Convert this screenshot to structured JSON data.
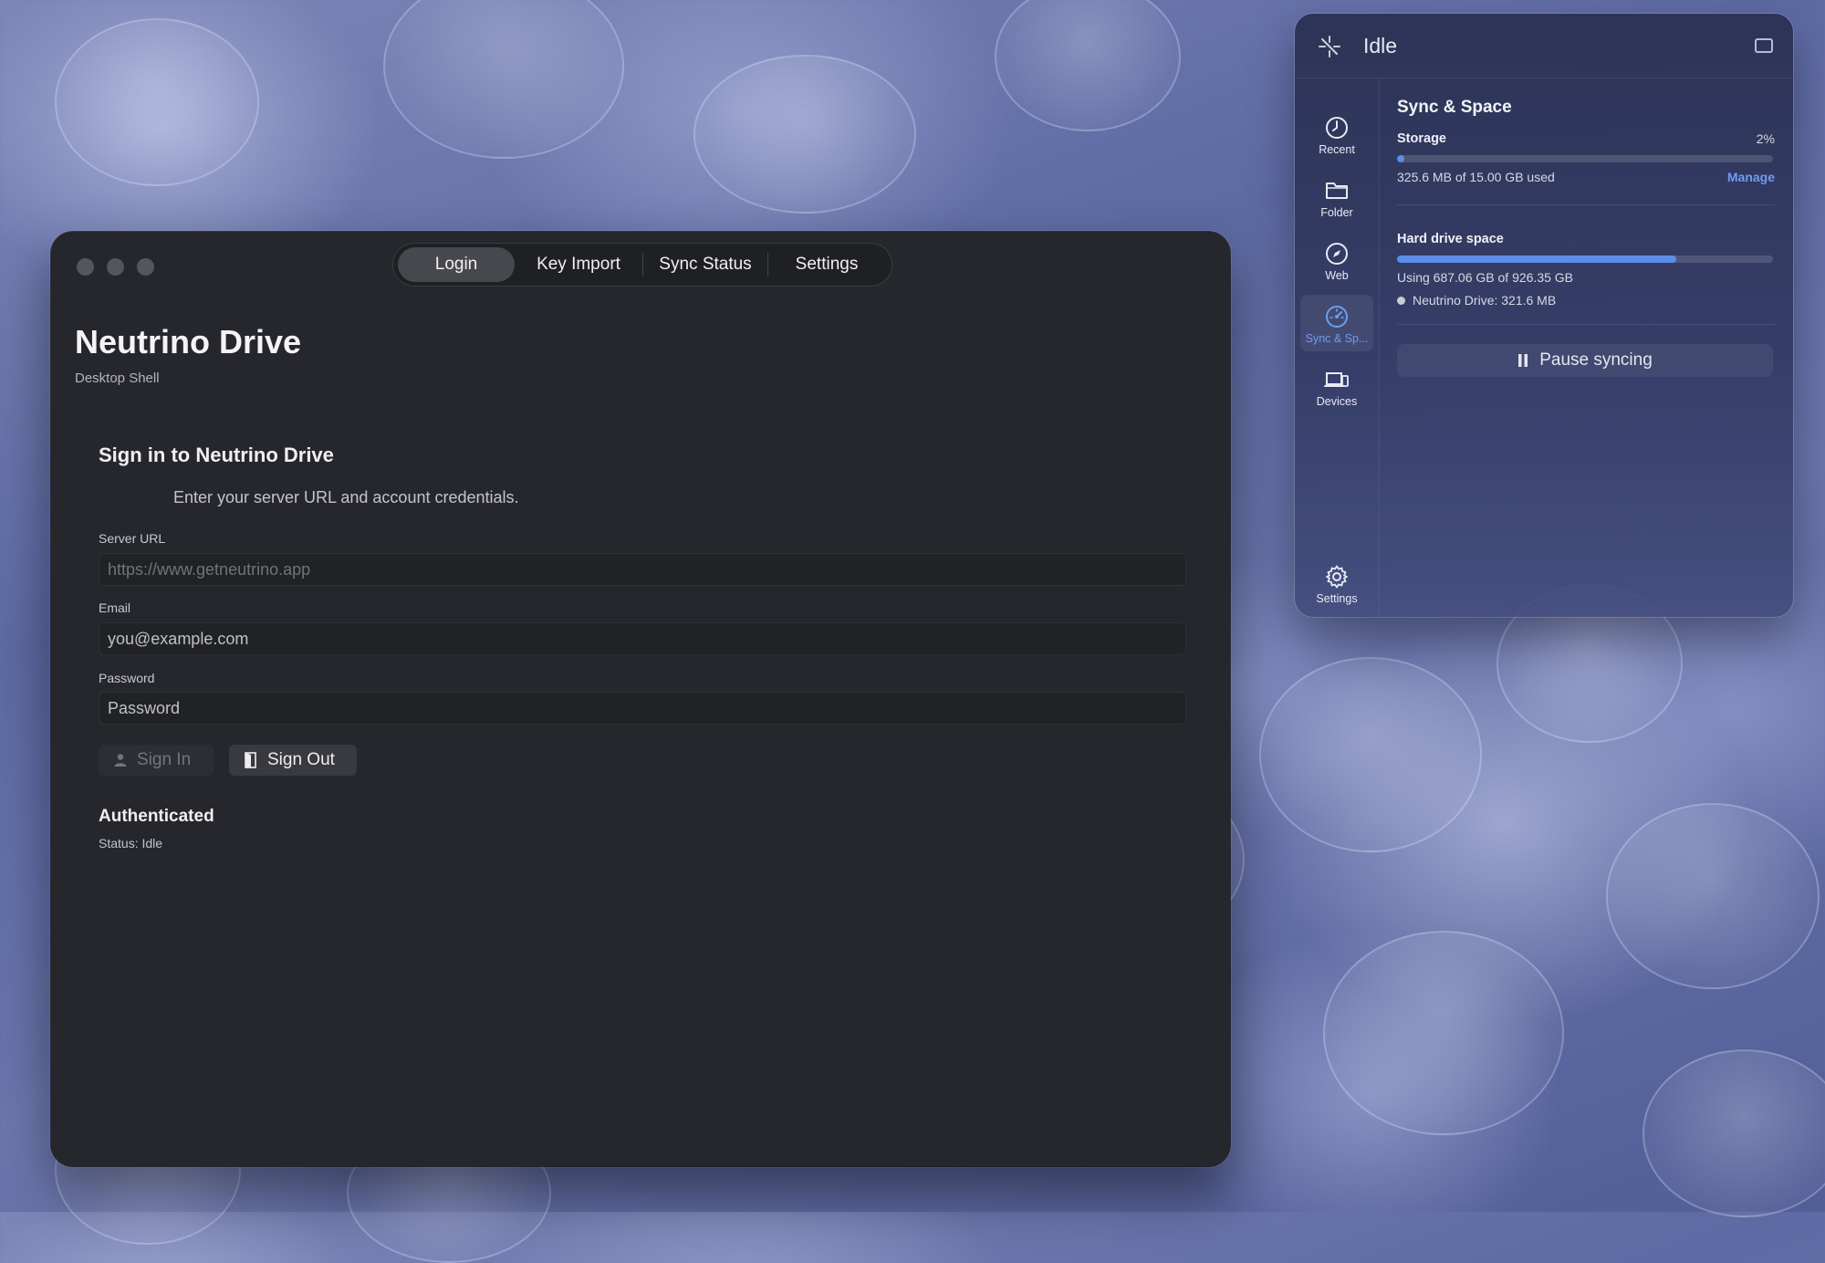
{
  "main_window": {
    "tabs": [
      "Login",
      "Key Import",
      "Sync Status",
      "Settings"
    ],
    "active_tab": "Login",
    "title": "Neutrino Drive",
    "subtitle": "Desktop Shell",
    "signin": {
      "heading": "Sign in to Neutrino Drive",
      "description": "Enter your server URL and account credentials.",
      "server_label": "Server URL",
      "server_placeholder": "https://www.getneutrino.app",
      "email_label": "Email",
      "email_placeholder": "you@example.com",
      "password_label": "Password",
      "password_placeholder": "Password",
      "signin_button": "Sign In",
      "signout_button": "Sign Out"
    },
    "auth": {
      "heading": "Authenticated",
      "status": "Status: Idle"
    }
  },
  "sync_panel": {
    "status": "Idle",
    "sidebar": [
      {
        "label": "Recent",
        "icon": "clock-icon"
      },
      {
        "label": "Folder",
        "icon": "folder-icon"
      },
      {
        "label": "Web",
        "icon": "compass-icon"
      },
      {
        "label": "Sync & Sp...",
        "icon": "gauge-icon",
        "active": true
      },
      {
        "label": "Devices",
        "icon": "devices-icon"
      },
      {
        "label": "Settings",
        "icon": "gear-icon"
      }
    ],
    "section_title": "Sync & Space",
    "storage": {
      "label": "Storage",
      "percent": "2%",
      "fill_fraction": 0.02,
      "used_text": "325.6 MB of 15.00 GB used",
      "manage_link": "Manage"
    },
    "hard_drive": {
      "label": "Hard drive space",
      "fill_fraction": 0.742,
      "using_text": "Using 687.06 GB of 926.35 GB",
      "app_usage": "Neutrino Drive: 321.6 MB"
    },
    "pause_button": "Pause syncing",
    "colors": {
      "accent": "#5b8de8",
      "active_label": "#6e9cf2"
    }
  }
}
